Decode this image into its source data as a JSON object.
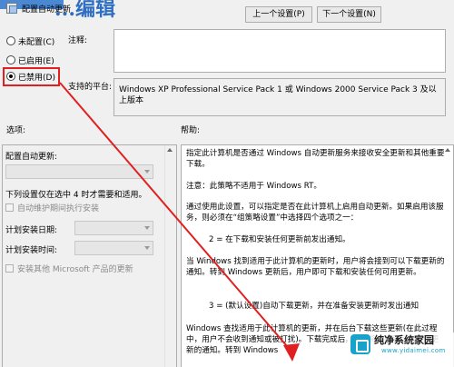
{
  "window": {
    "title": "配置自动更新",
    "banner_text": "...编辑"
  },
  "nav": {
    "prev_label": "上一个设置(P)",
    "next_label": "下一个设置(N)"
  },
  "state": {
    "options": [
      {
        "label": "未配置(C)",
        "selected": false
      },
      {
        "label": "已启用(E)",
        "selected": false
      },
      {
        "label": "已禁用(D)",
        "selected": true
      }
    ]
  },
  "comment": {
    "label": "注释:",
    "value": ""
  },
  "platform": {
    "label": "支持的平台:",
    "value": "Windows XP Professional Service Pack 1 或 Windows 2000 Service Pack 3 及以上版本"
  },
  "options_pane": {
    "heading": "选项:",
    "configure_label": "配置自动更新:",
    "note": "下列设置仅在选中 4 时才需要和适用。",
    "auto_maintenance_label": "自动维护期间执行安装",
    "install_day_label": "计划安装日期:",
    "install_time_label": "计划安装时间:",
    "other_products_label": "安装其他 Microsoft 产品的更新"
  },
  "help_pane": {
    "heading": "帮助:",
    "paragraphs": [
      "指定此计算机是否通过 Windows 自动更新服务来接收安全更新和其他重要下载。",
      "注意：此策略不适用于 Windows RT。",
      "通过使用此设置，可以指定是否在此计算机上启用自动更新。如果启用该服务，则必须在“组策略设置”中选择四个选项之一：",
      "2 = 在下载和安装任何更新前发出通知。",
      "当 Windows 找到适用于此计算机的更新时，用户将会接到可以下载更新的通知。转到 Windows 更新后，用户即可下载和安装任何可用更新。",
      "3 = (默认设置)自动下载更新，并在准备安装更新时发出通知",
      "Windows 查找适用于此计算机的更新，并在后台下载这些更新(在此过程中，用户不会收到通知或被打扰)。下载完成后，用户将会接到可以安装更新的通知。转到 Windows"
    ]
  },
  "annotation": {
    "arrow_color": "#e02020"
  },
  "watermark": {
    "title": "纯净系统家园",
    "url": "www.yidaimei.com"
  }
}
